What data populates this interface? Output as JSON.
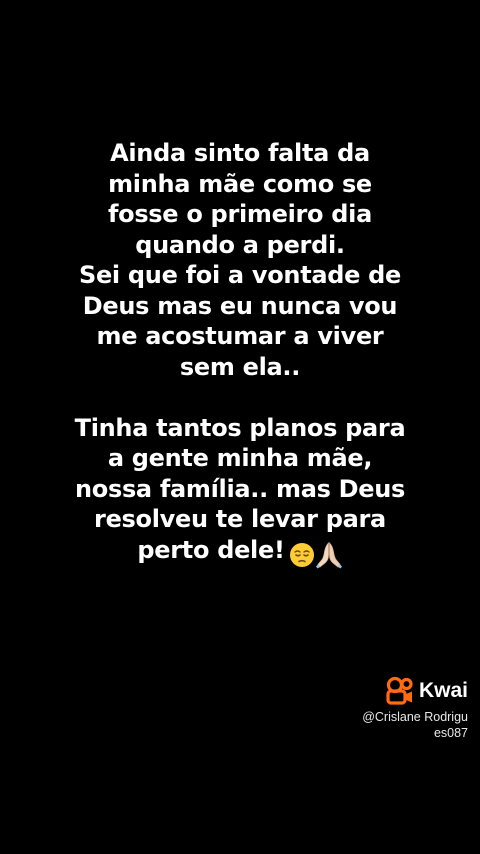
{
  "message": {
    "lines": [
      "Ainda sinto falta da",
      "minha mãe como se",
      "fosse o primeiro dia",
      "quando a perdi.",
      "Sei que foi a vontade de",
      "Deus mas eu nunca vou",
      "me acostumar a viver",
      "sem ela..",
      "Tinha tantos planos para",
      "a gente minha mãe,",
      "nossa família.. mas Deus",
      "resolveu te levar para",
      "perto dele!"
    ],
    "emojis": [
      "pensive-face-icon",
      "folded-hands-icon"
    ]
  },
  "watermark": {
    "brand": "Kwai",
    "handle_line1": "@Crislane Rodrigu",
    "handle_line2": "es087",
    "logo_icon": "kwai-camera-logo-icon",
    "logo_color": "#ff6a13"
  },
  "colors": {
    "background": "#000000",
    "text": "#ffffff"
  }
}
